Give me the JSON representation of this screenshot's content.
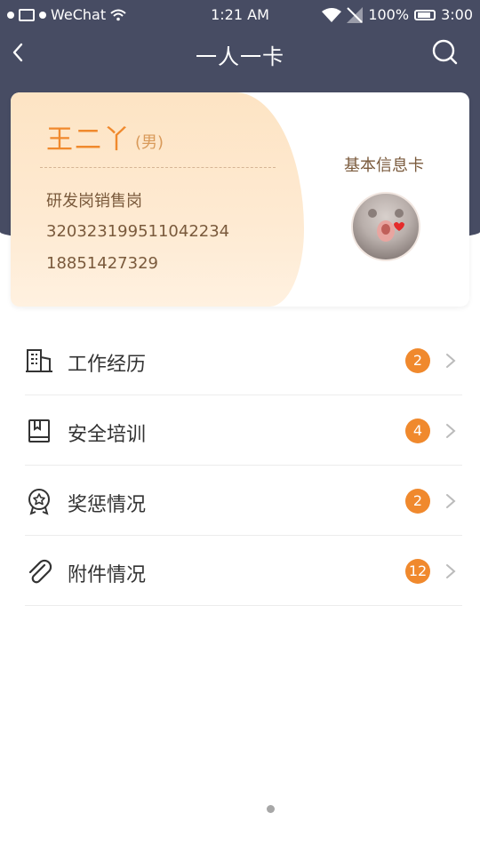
{
  "status_bar": {
    "carrier": "WeChat",
    "time": "1:21 AM",
    "battery": "100%",
    "clock_right": "3:00"
  },
  "nav": {
    "title": "一人一卡",
    "back_icon": "chevron-left-icon",
    "search_icon": "search-icon"
  },
  "card": {
    "name": "王二丫",
    "gender": "(男)",
    "position": "研发岗销售岗",
    "id_number": "320323199511042234",
    "phone": "18851427329",
    "label": "基本信息卡",
    "avatar_icon": "avatar"
  },
  "list": {
    "items": [
      {
        "label": "工作经历",
        "count": "2",
        "icon": "building-icon"
      },
      {
        "label": "安全培训",
        "count": "4",
        "icon": "book-icon"
      },
      {
        "label": "奖惩情况",
        "count": "2",
        "icon": "award-badge-icon"
      },
      {
        "label": "附件情况",
        "count": "12",
        "icon": "paperclip-icon"
      }
    ]
  },
  "colors": {
    "header": "#474c63",
    "accent": "#f0892d",
    "card_text": "#7a5a3c"
  }
}
